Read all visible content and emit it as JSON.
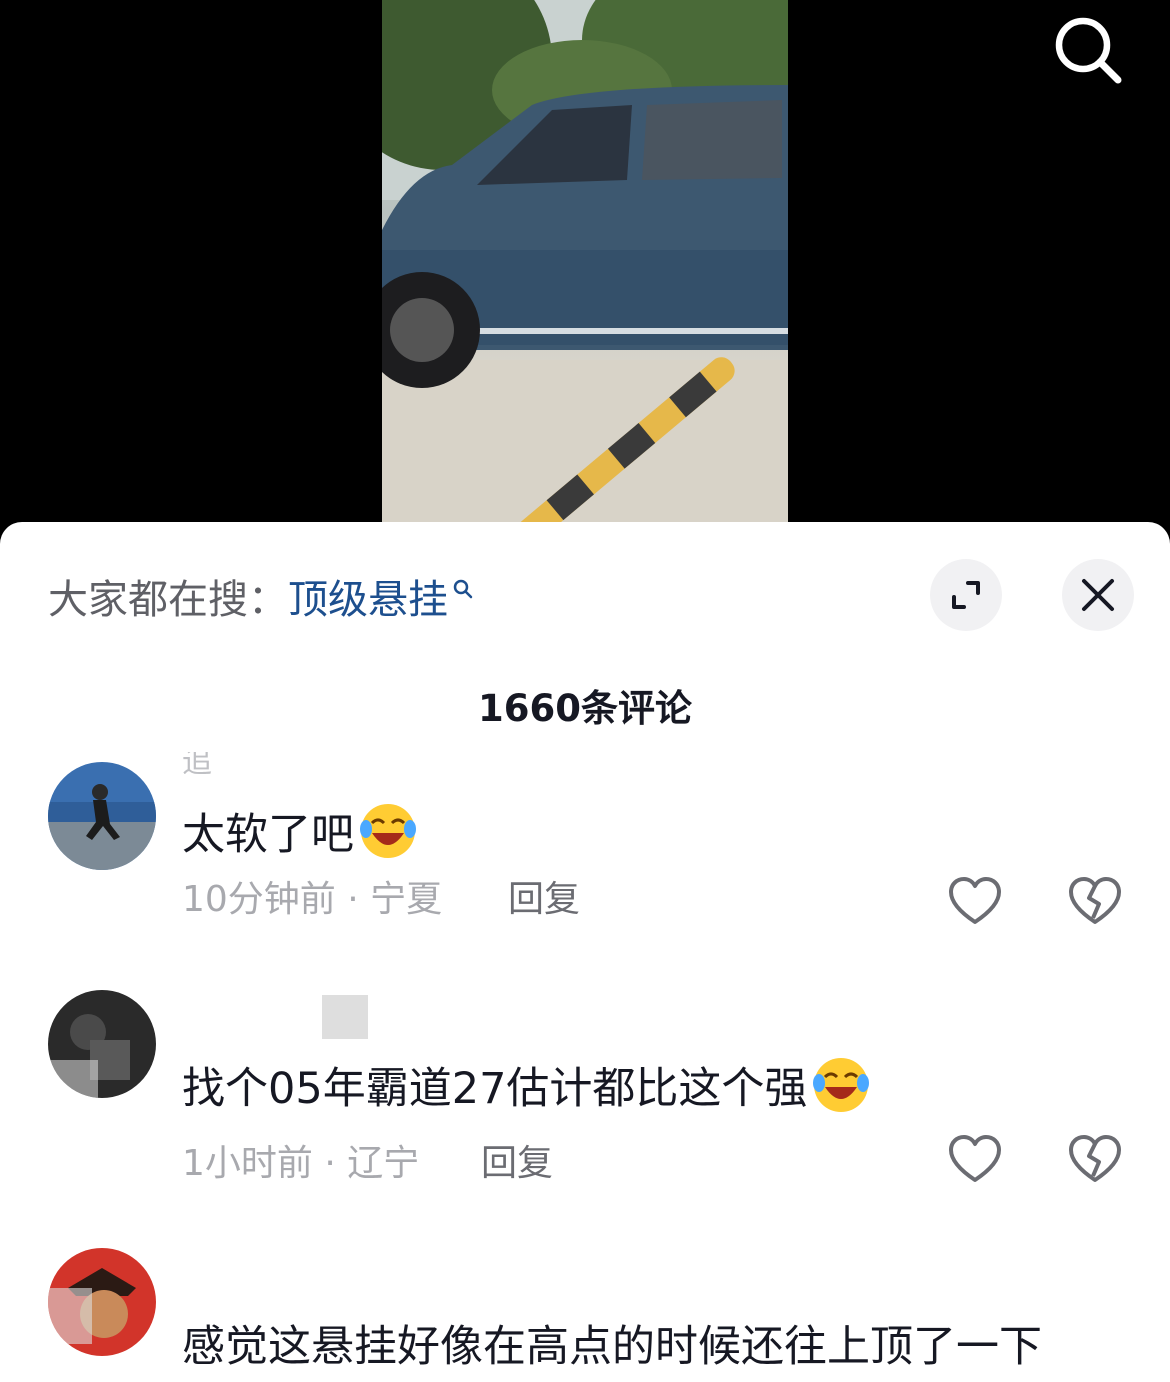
{
  "header": {
    "search_icon": "search-icon"
  },
  "sheet": {
    "hot_search_prefix": "大家都在搜：",
    "hot_search_term": "顶级悬挂",
    "expand_icon": "expand-icon",
    "close_icon": "close-icon",
    "comment_count_label": "1660条评论"
  },
  "comments": [
    {
      "username": "追",
      "text": "太软了吧",
      "emoji": "laughing-crying-emoji",
      "time": "10分钟前",
      "location": "宁夏",
      "meta": "10分钟前 · 宁夏",
      "reply_label": "回复"
    },
    {
      "username": "",
      "text": "找个05年霸道27估计都比这个强",
      "emoji": "laughing-crying-emoji",
      "time": "1小时前",
      "location": "辽宁",
      "meta": "1小时前 · 辽宁",
      "reply_label": "回复"
    },
    {
      "username": "",
      "text": "感觉这悬挂好像在高点的时候还往上顶了一下"
    }
  ],
  "colors": {
    "link_blue": "#1d4f8e",
    "text_primary": "#161823",
    "text_secondary": "#a8a9ae"
  }
}
